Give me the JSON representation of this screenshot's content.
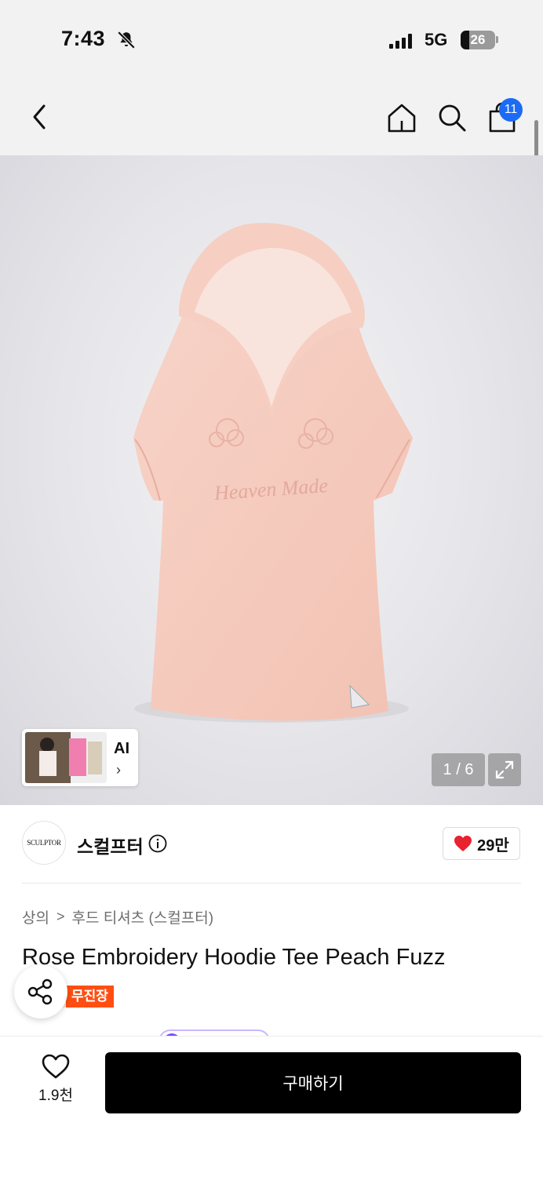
{
  "status_bar": {
    "time": "7:43",
    "network": "5G",
    "battery": "26",
    "battery_level": 0.26
  },
  "header": {
    "icons": [
      "back-icon",
      "home-icon",
      "search-icon",
      "cart-icon"
    ],
    "cart_badge": "11"
  },
  "gallery": {
    "ai_label": "AI",
    "ai_chevron": "›",
    "page_indicator": "1 / 6"
  },
  "brand": {
    "logo_text": "SCULPTOR",
    "name": "스컬프터",
    "likes": "29만"
  },
  "product": {
    "breadcrumb": [
      "상의",
      "후드 티셔츠 (스컬프터)"
    ],
    "breadcrumb_separator": ">",
    "title": "Rose Embroidery Hoodie Tee Peach Fuzz",
    "store_tag": "무진장",
    "embroidery_text": "Heaven Made"
  },
  "bottom_bar": {
    "wish_count": "1.9천",
    "buy_label": "구매하기"
  },
  "colors": {
    "accent_blue": "#1c6bf5",
    "tag_orange": "#ff4e12",
    "heart_red": "#e8222f",
    "buy_button": "#000000"
  }
}
